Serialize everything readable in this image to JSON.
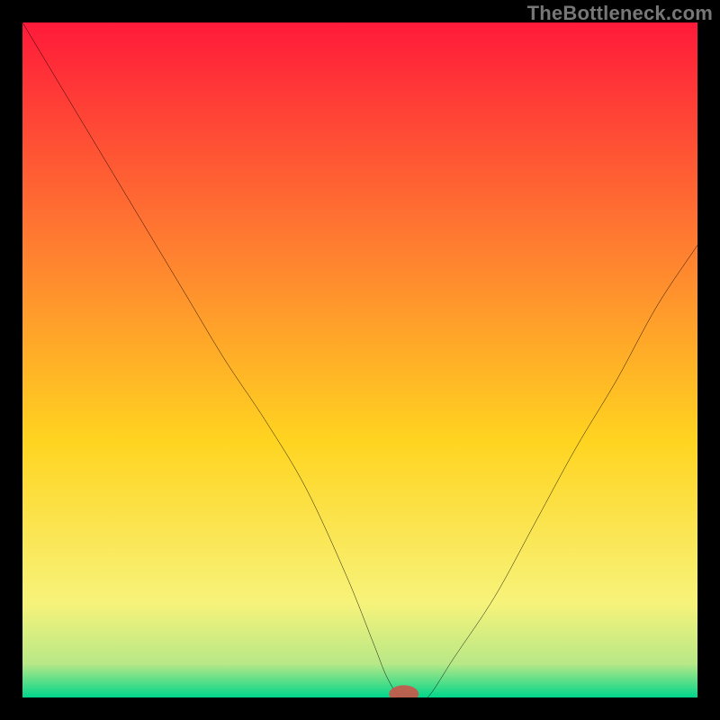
{
  "watermark": {
    "text": "TheBottleneck.com"
  },
  "chart_data": {
    "type": "line",
    "title": "",
    "xlabel": "",
    "ylabel": "",
    "xlim": [
      0,
      100
    ],
    "ylim": [
      0,
      100
    ],
    "grid": false,
    "legend": false,
    "background_gradient": {
      "top_color": "#ff1a3a",
      "mid_color_1": "#ff8030",
      "mid_color_2": "#ffd420",
      "bottom_color_1": "#f7f37a",
      "bottom_color_2": "#b8e887",
      "bottom_color_3": "#00d68a"
    },
    "series": [
      {
        "name": "curve",
        "x": [
          0,
          6,
          12,
          18,
          24,
          30,
          36,
          42,
          48,
          52,
          54,
          56,
          58,
          60,
          64,
          70,
          76,
          82,
          88,
          94,
          100
        ],
        "y": [
          100,
          90,
          80,
          70,
          60,
          50,
          41,
          31,
          18,
          8,
          3,
          0,
          0,
          0,
          6,
          15,
          26,
          37,
          47,
          58,
          67
        ]
      }
    ],
    "marker": {
      "x": 56.5,
      "y": 0,
      "rx": 2.2,
      "ry": 1.3,
      "color": "#c8574b"
    }
  }
}
